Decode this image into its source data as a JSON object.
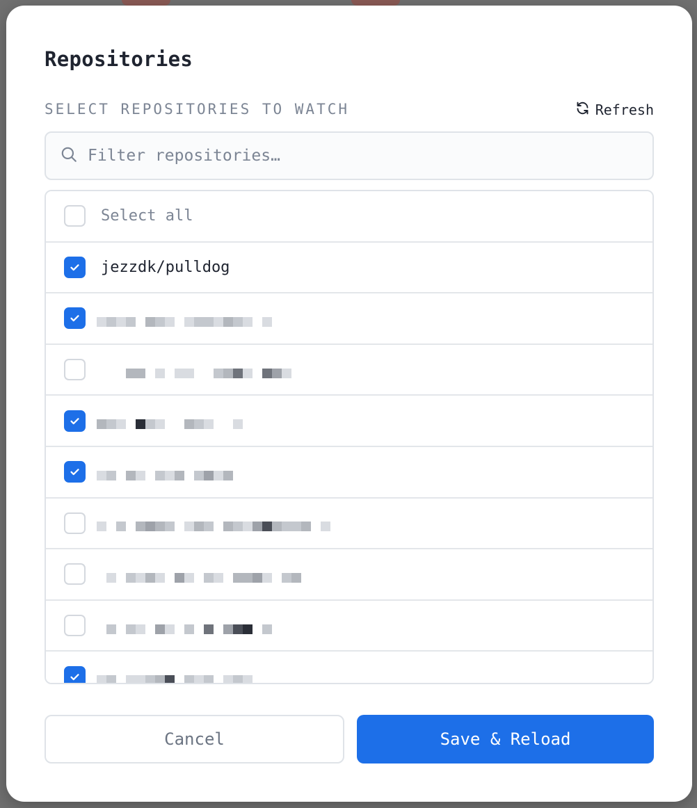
{
  "dialog": {
    "title": "Repositories",
    "section_label": "SELECT REPOSITORIES TO WATCH",
    "refresh_label": "Refresh"
  },
  "search": {
    "placeholder": "Filter repositories…",
    "value": ""
  },
  "list": {
    "select_all_label": "Select all",
    "select_all_checked": false,
    "items": [
      {
        "label": "jezzdk/pulldog",
        "checked": true
      },
      {
        "label": "",
        "checked": true
      },
      {
        "label": "",
        "checked": false
      },
      {
        "label": "",
        "checked": true
      },
      {
        "label": "",
        "checked": true
      },
      {
        "label": "",
        "checked": false
      },
      {
        "label": "",
        "checked": false
      },
      {
        "label": "",
        "checked": false
      },
      {
        "label": "",
        "checked": true
      }
    ]
  },
  "footer": {
    "cancel_label": "Cancel",
    "save_label": "Save & Reload"
  },
  "colors": {
    "accent": "#1d6fe8",
    "text": "#1f2430",
    "muted": "#7c8594",
    "border": "#dfe3e8"
  },
  "icons": {
    "refresh": "refresh-icon",
    "search": "search-icon",
    "check": "check-icon"
  }
}
